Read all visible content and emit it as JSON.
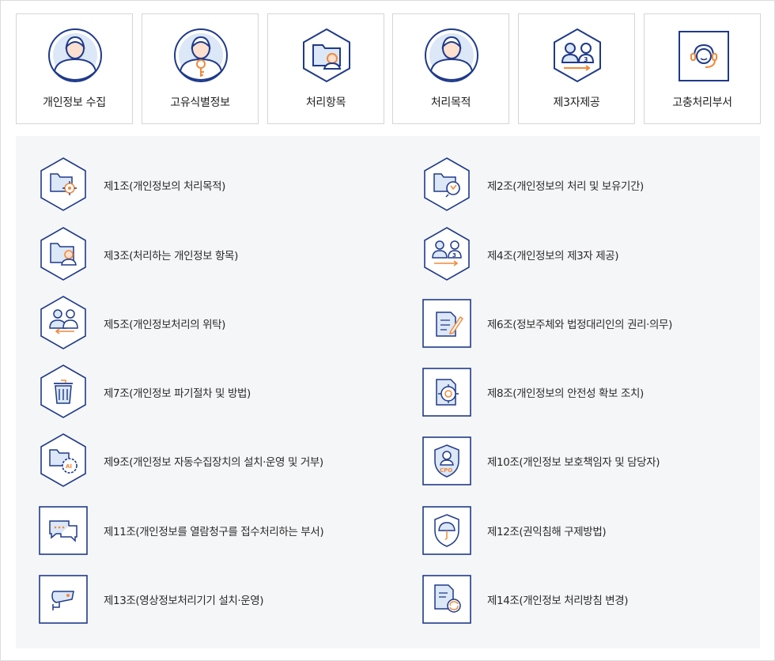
{
  "top_cards": [
    {
      "label": "개인정보 수집",
      "icon": "person-circle-icon"
    },
    {
      "label": "고유식별정보",
      "icon": "person-key-icon"
    },
    {
      "label": "처리항목",
      "icon": "folder-person-hexagon-icon"
    },
    {
      "label": "처리목적",
      "icon": "person-circle-icon"
    },
    {
      "label": "제3자제공",
      "icon": "third-party-hexagon-icon"
    },
    {
      "label": "고충처리부서",
      "icon": "headset-square-icon"
    }
  ],
  "articles": [
    {
      "label": "제1조(개인정보의 처리목적)",
      "icon": "folder-target-icon"
    },
    {
      "label": "제2조(개인정보의 처리 및 보유기간)",
      "icon": "folder-clock-icon"
    },
    {
      "label": "제3조(처리하는 개인정보 항목)",
      "icon": "folder-person-icon"
    },
    {
      "label": "제4조(개인정보의 제3자 제공)",
      "icon": "third-party-icon"
    },
    {
      "label": "제5조(개인정보처리의 위탁)",
      "icon": "consignment-icon"
    },
    {
      "label": "제6조(정보주체와 법정대리인의 권리·의무)",
      "icon": "document-pen-icon"
    },
    {
      "label": "제7조(개인정보 파기절차 및 방법)",
      "icon": "trash-icon"
    },
    {
      "label": "제8조(개인정보의 안전성 확보 조치)",
      "icon": "document-shield-icon"
    },
    {
      "label": "제9조(개인정보 자동수집장치의 설치·운영 및 거부)",
      "icon": "folder-ai-gear-icon"
    },
    {
      "label": "제10조(개인정보 보호책임자 및 담당자)",
      "icon": "cpo-shield-icon"
    },
    {
      "label": "제11조(개인정보를 열람청구를 접수처리하는 부서)",
      "icon": "chat-bubbles-icon"
    },
    {
      "label": "제12조(권익침해 구제방법)",
      "icon": "umbrella-shield-icon"
    },
    {
      "label": "제13조(영상정보처리기기 설치·운영)",
      "icon": "cctv-camera-icon"
    },
    {
      "label": "제14조(개인정보 처리방침 변경)",
      "icon": "document-refresh-icon"
    }
  ],
  "colors": {
    "navy": "#1f3a8a",
    "orange": "#f08a3c",
    "light_blue": "#dce7f7",
    "skin": "#fde0cf"
  }
}
